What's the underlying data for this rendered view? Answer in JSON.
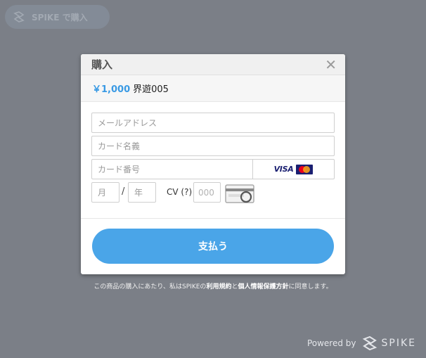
{
  "top_button": {
    "label": "SPIKE で購入"
  },
  "modal": {
    "title": "購入",
    "price": "￥1,000",
    "product_name": "界遊005",
    "fields": {
      "email_placeholder": "メールアドレス",
      "card_name_placeholder": "カード名義",
      "card_number_placeholder": "カード番号",
      "month_placeholder": "月",
      "year_placeholder": "年",
      "cvc_placeholder": "000"
    },
    "slash": "/",
    "cv_label": "CV (?)",
    "card_brands": {
      "visa": "VISA",
      "mastercard": "MasterCard"
    },
    "pay_button": "支払う"
  },
  "terms": {
    "prefix": "この商品の購入にあたり、私はSPIKEの",
    "link1": "利用規約",
    "middle": "と",
    "link2": "個人情報保護方針",
    "suffix": "に同意します。"
  },
  "footer": {
    "powered_by": "Powered by",
    "brand": "SPIKE"
  },
  "colors": {
    "accent": "#4aa5e8",
    "price": "#3a9ae4",
    "backdrop": "#7b7f87"
  }
}
